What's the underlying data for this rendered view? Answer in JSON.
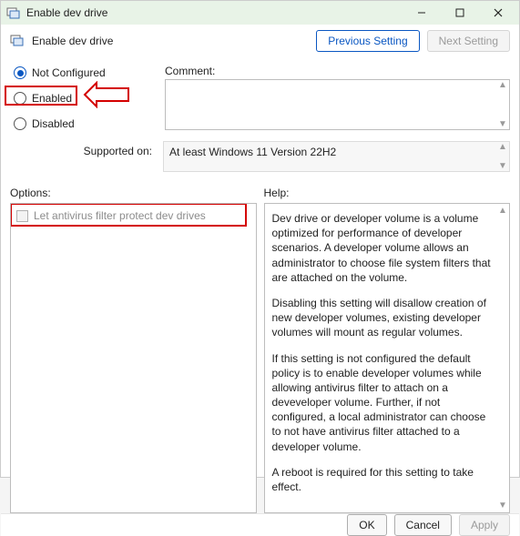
{
  "window": {
    "title": "Enable dev drive"
  },
  "header": {
    "label": "Enable dev drive",
    "prev_btn": "Previous Setting",
    "next_btn": "Next Setting"
  },
  "radios": {
    "not_configured": "Not Configured",
    "enabled": "Enabled",
    "disabled": "Disabled"
  },
  "fields": {
    "comment_label": "Comment:",
    "supported_label": "Supported on:",
    "supported_value": "At least Windows 11 Version 22H2"
  },
  "columns": {
    "options_label": "Options:",
    "help_label": "Help:"
  },
  "options": {
    "av_checkbox_label": "Let antivirus filter protect dev drives"
  },
  "help": {
    "p1": "Dev drive or developer volume is a volume optimized for performance of developer scenarios. A developer volume allows an administrator to choose file system filters that are attached on the volume.",
    "p2": "Disabling this setting will disallow creation of new developer volumes, existing developer volumes will mount as regular volumes.",
    "p3": "If this setting is not configured the default policy is to enable developer volumes while allowing antivirus filter to attach on a deveveloper volume.  Further, if not configured, a local administrator can choose to not have antivirus filter attached to a developer volume.",
    "p4": "A reboot is required for this setting to take effect."
  },
  "footer": {
    "ok": "OK",
    "cancel": "Cancel",
    "apply": "Apply"
  }
}
